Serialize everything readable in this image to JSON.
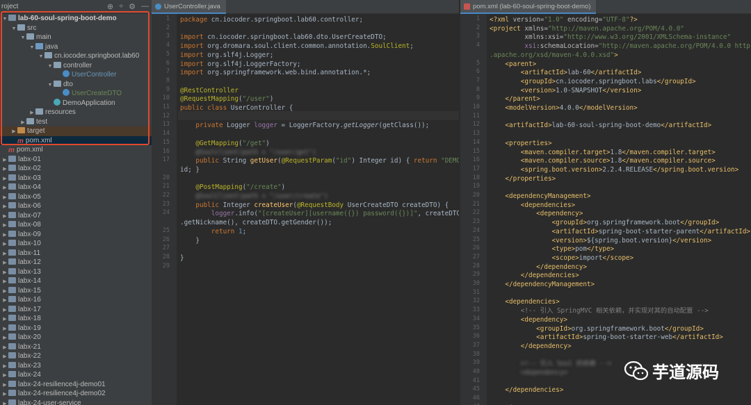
{
  "project": {
    "title": "roject",
    "tree": [
      {
        "label": "lab-60-soul-spring-boot-demo",
        "depth": 0,
        "arrow": "▼",
        "icon": "mod",
        "bold": true
      },
      {
        "label": "src",
        "depth": 1,
        "arrow": "▼",
        "icon": "folder"
      },
      {
        "label": "main",
        "depth": 2,
        "arrow": "▼",
        "icon": "folder"
      },
      {
        "label": "java",
        "depth": 3,
        "arrow": "▼",
        "icon": "folder-g"
      },
      {
        "label": "cn.iocoder.springboot.lab60",
        "depth": 4,
        "arrow": "▼",
        "icon": "pkg"
      },
      {
        "label": "controller",
        "depth": 5,
        "arrow": "▼",
        "icon": "pkg"
      },
      {
        "label": "UserController",
        "depth": 6,
        "arrow": "",
        "icon": "cls",
        "color": "blue"
      },
      {
        "label": "dto",
        "depth": 5,
        "arrow": "▼",
        "icon": "pkg"
      },
      {
        "label": "UserCreateDTO",
        "depth": 6,
        "arrow": "",
        "icon": "cls",
        "color": "green"
      },
      {
        "label": "DemoApplication",
        "depth": 5,
        "arrow": "",
        "icon": "cls-a"
      },
      {
        "label": "resources",
        "depth": 3,
        "arrow": "▶",
        "icon": "folder"
      },
      {
        "label": "test",
        "depth": 2,
        "arrow": "▶",
        "icon": "folder"
      },
      {
        "label": "target",
        "depth": 1,
        "arrow": "▶",
        "icon": "folder-o",
        "state": "target"
      },
      {
        "label": "pom.xml",
        "depth": 1,
        "arrow": "",
        "icon": "mvn",
        "state": "sel"
      },
      {
        "label": "pom.xml",
        "depth": 0,
        "arrow": "",
        "icon": "mvn"
      },
      {
        "label": "labx-01",
        "depth": 0,
        "arrow": "▶",
        "icon": "mod"
      },
      {
        "label": "labx-02",
        "depth": 0,
        "arrow": "▶",
        "icon": "mod"
      },
      {
        "label": "labx-03",
        "depth": 0,
        "arrow": "▶",
        "icon": "mod"
      },
      {
        "label": "labx-04",
        "depth": 0,
        "arrow": "▶",
        "icon": "mod"
      },
      {
        "label": "labx-05",
        "depth": 0,
        "arrow": "▶",
        "icon": "mod"
      },
      {
        "label": "labx-06",
        "depth": 0,
        "arrow": "▶",
        "icon": "mod"
      },
      {
        "label": "labx-07",
        "depth": 0,
        "arrow": "▶",
        "icon": "mod"
      },
      {
        "label": "labx-08",
        "depth": 0,
        "arrow": "▶",
        "icon": "mod"
      },
      {
        "label": "labx-09",
        "depth": 0,
        "arrow": "▶",
        "icon": "mod"
      },
      {
        "label": "labx-10",
        "depth": 0,
        "arrow": "▶",
        "icon": "mod"
      },
      {
        "label": "labx-11",
        "depth": 0,
        "arrow": "▶",
        "icon": "mod"
      },
      {
        "label": "labx-12",
        "depth": 0,
        "arrow": "▶",
        "icon": "mod"
      },
      {
        "label": "labx-13",
        "depth": 0,
        "arrow": "▶",
        "icon": "mod"
      },
      {
        "label": "labx-14",
        "depth": 0,
        "arrow": "▶",
        "icon": "mod"
      },
      {
        "label": "labx-15",
        "depth": 0,
        "arrow": "▶",
        "icon": "mod"
      },
      {
        "label": "labx-16",
        "depth": 0,
        "arrow": "▶",
        "icon": "mod"
      },
      {
        "label": "labx-17",
        "depth": 0,
        "arrow": "▶",
        "icon": "mod"
      },
      {
        "label": "labx-18",
        "depth": 0,
        "arrow": "▶",
        "icon": "mod"
      },
      {
        "label": "labx-19",
        "depth": 0,
        "arrow": "▶",
        "icon": "mod"
      },
      {
        "label": "labx-20",
        "depth": 0,
        "arrow": "▶",
        "icon": "mod"
      },
      {
        "label": "labx-21",
        "depth": 0,
        "arrow": "▶",
        "icon": "mod"
      },
      {
        "label": "labx-22",
        "depth": 0,
        "arrow": "▶",
        "icon": "mod"
      },
      {
        "label": "labx-23",
        "depth": 0,
        "arrow": "▶",
        "icon": "mod"
      },
      {
        "label": "labx-24",
        "depth": 0,
        "arrow": "▶",
        "icon": "mod"
      },
      {
        "label": "labx-24-resilience4j-demo01",
        "depth": 0,
        "arrow": "▶",
        "icon": "mod"
      },
      {
        "label": "labx-24-resilience4j-demo02",
        "depth": 0,
        "arrow": "▶",
        "icon": "mod"
      },
      {
        "label": "labx-24-user-service",
        "depth": 0,
        "arrow": "▶",
        "icon": "mod"
      }
    ]
  },
  "java_tab": {
    "label": "UserController.java"
  },
  "xml_tab": {
    "label": "pom.xml (lab-60-soul-spring-boot-demo)"
  },
  "java_lines": [
    {
      "n": "1",
      "y": 0,
      "h": "<span class='kw'>package</span> cn.iocoder.springboot.lab60.controller;"
    },
    {
      "n": "2",
      "y": 1,
      "h": ""
    },
    {
      "n": "3",
      "y": 2,
      "h": "<span class='kw'>import</span> cn.iocoder.springboot.lab60.dto.UserCreateDTO;"
    },
    {
      "n": "4",
      "y": 3,
      "h": "<span class='kw'>import</span> org.dromara.soul.client.common.annotation.<span class='an'>SoulClient</span>;"
    },
    {
      "n": "5",
      "y": 4,
      "h": "<span class='kw'>import</span> org.slf4j.Logger;"
    },
    {
      "n": "6",
      "y": 5,
      "h": "<span class='kw'>import</span> org.slf4j.LoggerFactory;"
    },
    {
      "n": "7",
      "y": 6,
      "h": "<span class='kw'>import</span> org.springframework.web.bind.annotation.*;"
    },
    {
      "n": "8",
      "y": 7,
      "h": ""
    },
    {
      "n": "9",
      "y": 8,
      "h": "<span class='an'>@RestController</span>"
    },
    {
      "n": "10",
      "y": 9,
      "h": "<span class='an'>@RequestMapping</span>(<span class='st'>\"/user\"</span>)"
    },
    {
      "n": "11",
      "y": 10,
      "h": "<span class='kw'>public class</span> UserController {"
    },
    {
      "n": "12",
      "y": 11,
      "h": ""
    },
    {
      "n": "13",
      "y": 12,
      "h": "    <span class='kw'>private</span> Logger <span class='vr'>logger</span> = LoggerFactory.<span class='it'>getLogger</span>(getClass());"
    },
    {
      "n": "14",
      "y": 13,
      "h": ""
    },
    {
      "n": "15",
      "y": 14,
      "h": "    <span class='an'>@GetMapping</span>(<span class='st'>\"/get\"</span>)"
    },
    {
      "n": "16",
      "y": 15,
      "h": "    <span class='blur'>@SoulClient(path = \"/user/get\")</span>"
    },
    {
      "n": "17",
      "y": 16,
      "h": "    <span class='kw'>public</span> String <span class='fn'>getUser</span>(<span class='an'>@RequestParam</span>(<span class='st'>\"id\"</span>) Integer id) { <span class='kw'>return</span> <span class='st'>\"DEMO:\"</span> +"
    },
    {
      "n": "",
      "y": 17,
      "h": "id; }"
    },
    {
      "n": "20",
      "y": 18,
      "h": ""
    },
    {
      "n": "21",
      "y": 19,
      "h": "    <span class='an'>@PostMapping</span>(<span class='st'>\"/create\"</span>)"
    },
    {
      "n": "22",
      "y": 20,
      "h": "    <span class='blur'>@SoulClient(path = \"/user/create\")</span>"
    },
    {
      "n": "23",
      "y": 21,
      "h": "    <span class='kw'>public</span> Integer <span class='fn'>createUser</span>(<span class='an'>@RequestBody</span> UserCreateDTO createDTO) {"
    },
    {
      "n": "24",
      "y": 22,
      "h": "        <span class='vr'>logger</span>.info(<span class='st'>\"[createUser][username({}) password({})]\"</span>, createDTO"
    },
    {
      "n": "",
      "y": 23,
      "h": ".getNickname(), createDTO.getGender());"
    },
    {
      "n": "25",
      "y": 24,
      "h": "        <span class='kw'>return</span> <span class='fn' style='color:#6897bb'>1</span>;"
    },
    {
      "n": "26",
      "y": 25,
      "h": "    }"
    },
    {
      "n": "27",
      "y": 26,
      "h": ""
    },
    {
      "n": "28",
      "y": 27,
      "h": "}"
    },
    {
      "n": "29",
      "y": 28,
      "h": ""
    }
  ],
  "xml_lines": [
    {
      "n": "1",
      "h": "<span class='tg'>&lt;?xml</span> <span class='at'>version=</span><span class='av'>\"1.0\"</span> <span class='at'>encoding=</span><span class='av'>\"UTF-8\"</span><span class='tg'>?&gt;</span>"
    },
    {
      "n": "2",
      "h": "<span class='tg'>&lt;project</span> <span class='at'>xmlns=</span><span class='av'>\"http://maven.apache.org/POM/4.0.0\"</span>"
    },
    {
      "n": "3",
      "h": "         <span class='at'>xmlns:xsi=</span><span class='av'>\"http://www.w3.org/2001/XMLSchema-instance\"</span>"
    },
    {
      "n": "4",
      "h": "         <span class='vr'>xsi</span><span class='at'>:schemaLocation=</span><span class='av'>\"http://maven.apache.org/POM/4.0.0 http://maven</span>"
    },
    {
      "n": "",
      "h": "<span class='av'>.apache.org/xsd/maven-4.0.0.xsd\"</span><span class='tg'>&gt;</span>"
    },
    {
      "n": "5",
      "h": "    <span class='tg'>&lt;parent&gt;</span>"
    },
    {
      "n": "6",
      "h": "        <span class='tg'>&lt;artifactId&gt;</span>lab-60<span class='tg'>&lt;/artifactId&gt;</span>"
    },
    {
      "n": "7",
      "h": "        <span class='tg'>&lt;groupId&gt;</span>cn.iocoder.springboot.labs<span class='tg'>&lt;/groupId&gt;</span>"
    },
    {
      "n": "8",
      "h": "        <span class='tg'>&lt;version&gt;</span>1.0-SNAPSHOT<span class='tg'>&lt;/version&gt;</span>"
    },
    {
      "n": "9",
      "h": "    <span class='tg'>&lt;/parent&gt;</span>"
    },
    {
      "n": "10",
      "h": "    <span class='tg'>&lt;modelVersion&gt;</span>4.0.0<span class='tg'>&lt;/modelVersion&gt;</span>"
    },
    {
      "n": "11",
      "h": ""
    },
    {
      "n": "12",
      "h": "    <span class='tg'>&lt;artifactId&gt;</span>lab-60-soul-spring-boot-demo<span class='tg'>&lt;/artifactId&gt;</span>"
    },
    {
      "n": "13",
      "h": ""
    },
    {
      "n": "14",
      "h": "    <span class='tg'>&lt;properties&gt;</span>"
    },
    {
      "n": "15",
      "h": "        <span class='tg'>&lt;maven.compiler.target&gt;</span>1.8<span class='tg'>&lt;/maven.compiler.target&gt;</span>"
    },
    {
      "n": "16",
      "h": "        <span class='tg'>&lt;maven.compiler.source&gt;</span>1.8<span class='tg'>&lt;/maven.compiler.source&gt;</span>"
    },
    {
      "n": "17",
      "h": "        <span class='tg'>&lt;spring.boot.version&gt;</span>2.2.4.RELEASE<span class='tg'>&lt;/spring.boot.version&gt;</span>"
    },
    {
      "n": "18",
      "h": "    <span class='tg'>&lt;/properties&gt;</span>"
    },
    {
      "n": "19",
      "h": ""
    },
    {
      "n": "20",
      "h": "    <span class='tg'>&lt;dependencyManagement&gt;</span>"
    },
    {
      "n": "21",
      "h": "        <span class='tg'>&lt;dependencies&gt;</span>"
    },
    {
      "n": "22",
      "h": "            <span class='tg'>&lt;dependency&gt;</span>"
    },
    {
      "n": "23",
      "h": "                <span class='tg'>&lt;groupId&gt;</span>org.springframework.boot<span class='tg'>&lt;/groupId&gt;</span>"
    },
    {
      "n": "24",
      "h": "                <span class='tg'>&lt;artifactId&gt;</span>spring-boot-starter-parent<span class='tg'>&lt;/artifactId&gt;</span>"
    },
    {
      "n": "25",
      "h": "                <span class='tg'>&lt;version&gt;</span>${spring.boot.version}<span class='tg'>&lt;/version&gt;</span>"
    },
    {
      "n": "26",
      "h": "                <span class='tg'>&lt;type&gt;</span>pom<span class='tg'>&lt;/type&gt;</span>"
    },
    {
      "n": "27",
      "h": "                <span class='tg'>&lt;scope&gt;</span>import<span class='tg'>&lt;/scope&gt;</span>"
    },
    {
      "n": "28",
      "h": "            <span class='tg'>&lt;/dependency&gt;</span>"
    },
    {
      "n": "29",
      "h": "        <span class='tg'>&lt;/dependencies&gt;</span>"
    },
    {
      "n": "30",
      "h": "    <span class='tg'>&lt;/dependencyManagement&gt;</span>"
    },
    {
      "n": "31",
      "h": ""
    },
    {
      "n": "32",
      "h": "    <span class='tg'>&lt;dependencies&gt;</span>"
    },
    {
      "n": "33",
      "h": "        <span class='cm'>&lt;!-- 引入 SpringMVC 相关依赖，并实现对其的自动配置 --&gt;</span>"
    },
    {
      "n": "34",
      "h": "        <span class='tg'>&lt;dependency&gt;</span>"
    },
    {
      "n": "35",
      "h": "            <span class='tg'>&lt;groupId&gt;</span>org.springframework.boot<span class='tg'>&lt;/groupId&gt;</span>"
    },
    {
      "n": "36",
      "h": "            <span class='tg'>&lt;artifactId&gt;</span>spring-boot-starter-web<span class='tg'>&lt;/artifactId&gt;</span>"
    },
    {
      "n": "37",
      "h": "        <span class='tg'>&lt;/dependency&gt;</span>"
    },
    {
      "n": "38",
      "h": ""
    },
    {
      "n": "39",
      "h": "        <span class='blur'>&lt;!-- 引入 Soul 的依赖 --&gt;</span>"
    },
    {
      "n": "40",
      "h": "        <span class='blur'>&lt;dependency&gt;</span>"
    },
    {
      "n": "41",
      "h": ""
    },
    {
      "n": "45",
      "h": "    <span class='tg'>&lt;/dependencies&gt;</span>"
    },
    {
      "n": "46",
      "h": ""
    },
    {
      "n": "47",
      "h": "<span class='tg'>&lt;/project&gt;</span>"
    }
  ],
  "watermark": {
    "text": "芋道源码"
  }
}
